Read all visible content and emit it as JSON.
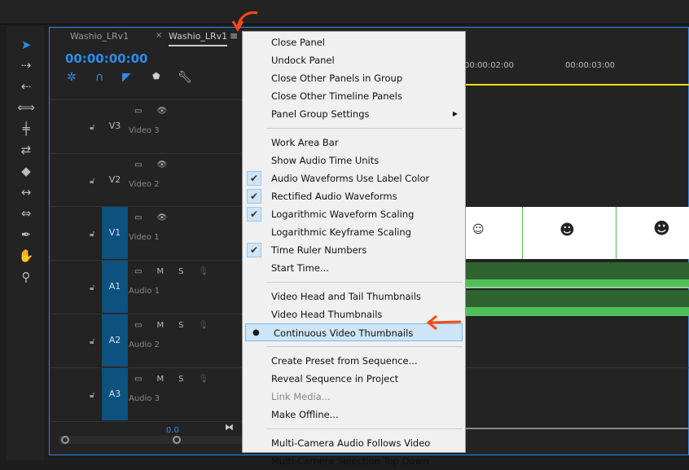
{
  "tabs": [
    {
      "label": "Washio_LRv1"
    },
    {
      "label": "Washio_LRv1",
      "close": "×"
    }
  ],
  "timecode": "00:00:00:00",
  "ruler": {
    "labels": [
      "00:00:02:00",
      "00:00:03:00"
    ]
  },
  "tracks": [
    {
      "id": "V3",
      "name": "Video 3",
      "targeted": false,
      "kind": "video"
    },
    {
      "id": "V2",
      "name": "Video 2",
      "targeted": false,
      "kind": "video"
    },
    {
      "id": "V1",
      "name": "Video 1",
      "targeted": true,
      "kind": "video"
    },
    {
      "id": "A1",
      "name": "Audio 1",
      "targeted": true,
      "kind": "audio"
    },
    {
      "id": "A2",
      "name": "Audio 2",
      "targeted": true,
      "kind": "audio"
    },
    {
      "id": "A3",
      "name": "Audio 3",
      "targeted": true,
      "kind": "audio"
    }
  ],
  "audio_buttons": {
    "mute": "M",
    "solo": "S"
  },
  "zoom_value": "0.0",
  "menu": {
    "items": [
      {
        "label": "Close Panel"
      },
      {
        "label": "Undock Panel"
      },
      {
        "label": "Close Other Panels in Group"
      },
      {
        "label": "Close Other Timeline Panels"
      },
      {
        "label": "Panel Group Settings",
        "submenu": true
      },
      {
        "sep": true
      },
      {
        "label": "Work Area Bar"
      },
      {
        "label": "Show Audio Time Units"
      },
      {
        "label": "Audio Waveforms Use Label Color",
        "checked": true
      },
      {
        "label": "Rectified Audio Waveforms",
        "checked": true
      },
      {
        "label": "Logarithmic Waveform Scaling",
        "checked": true
      },
      {
        "label": "Logarithmic Keyframe Scaling"
      },
      {
        "label": "Time Ruler Numbers",
        "checked": true
      },
      {
        "label": "Start Time..."
      },
      {
        "sep": true
      },
      {
        "label": "Video Head and Tail Thumbnails"
      },
      {
        "label": "Video Head Thumbnails"
      },
      {
        "label": "Continuous Video Thumbnails",
        "radio": true,
        "selected": true
      },
      {
        "sep": true
      },
      {
        "label": "Create Preset from Sequence..."
      },
      {
        "label": "Reveal Sequence in Project"
      },
      {
        "label": "Link Media...",
        "disabled": true
      },
      {
        "label": "Make Offline..."
      },
      {
        "sep": true
      },
      {
        "label": "Multi-Camera Audio Follows Video"
      },
      {
        "label": "Multi-Camera Selection Top Down"
      }
    ]
  },
  "colors": {
    "accent": "#2d8ceb",
    "target": "#0b5280",
    "playhead_bar": "#f0e000",
    "waveform": "#4fbf5a",
    "annotation": "#ff4a10"
  }
}
